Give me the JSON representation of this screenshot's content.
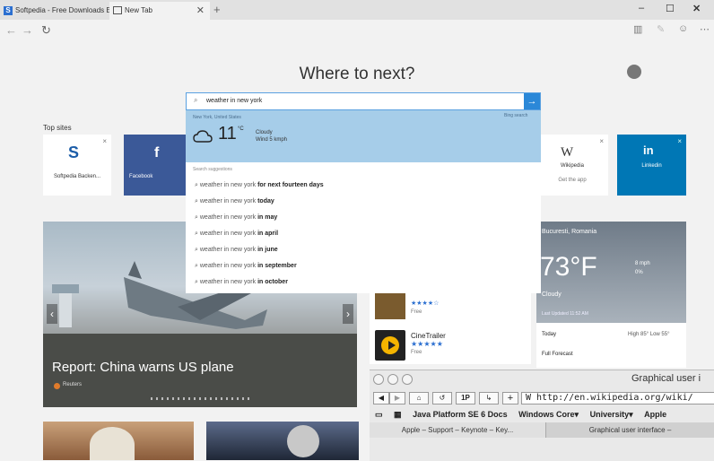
{
  "tabs": [
    {
      "label": "Softpedia - Free Downloads En"
    },
    {
      "label": "New Tab"
    }
  ],
  "heading": "Where to next?",
  "top_sites_label": "Top sites",
  "top_sites": [
    {
      "label": "Softpedia Backen...",
      "glyph": "S"
    },
    {
      "label": "Facebook",
      "glyph": "f"
    },
    {
      "label": "Wikipedia",
      "sublabel": "Get the app",
      "glyph": "W"
    },
    {
      "label": "Linkedin",
      "glyph": "in"
    }
  ],
  "search": {
    "query": "weather in new york",
    "weather": {
      "location": "New York, United States",
      "source": "Bing search",
      "temp": "11",
      "unit": "°C",
      "condition": "Cloudy",
      "wind": "Wind 5 kmph"
    },
    "suggestions_label": "Search suggestions",
    "suggestion_prefix": "weather in new york",
    "suggestions": [
      "for next fourteen days",
      "today",
      "in may",
      "in april",
      "in june",
      "in september",
      "in october"
    ]
  },
  "news": {
    "headline": "Report: China warns US plane",
    "source": "Reuters"
  },
  "store": {
    "items": [
      {
        "title": "",
        "rating": "★★★★☆",
        "price": "Free"
      },
      {
        "title": "CineTrailer",
        "rating": "★★★★★",
        "price": "Free"
      }
    ]
  },
  "weather_card": {
    "location": "Bucuresti, Romania",
    "temp": "73°F",
    "wind": "8 mph",
    "precip": "0%",
    "condition": "Cloudy",
    "updated": "Last Updated 11:52 AM",
    "today_label": "Today",
    "today_range": "High 85° Low 55°",
    "forecast_label": "Full Forecast"
  },
  "mac_window": {
    "title": "Graphical user i",
    "url": "W http://en.wikipedia.org/wiki/",
    "bookmarks": [
      "Java Platform SE 6 Docs",
      "Windows Core▾",
      "University▾",
      "Apple"
    ],
    "tabs": [
      "Apple – Support – Keynote – Key...",
      "Graphical user interface – "
    ],
    "buttons": [
      "◀",
      "▶",
      "⌂",
      "↺",
      "1P",
      "↳",
      "+"
    ]
  },
  "colors": {
    "accent": "#2b88d8",
    "facebook": "#3b5998",
    "linkedin": "#0077b5",
    "weather_highlight": "#a6cde9"
  }
}
